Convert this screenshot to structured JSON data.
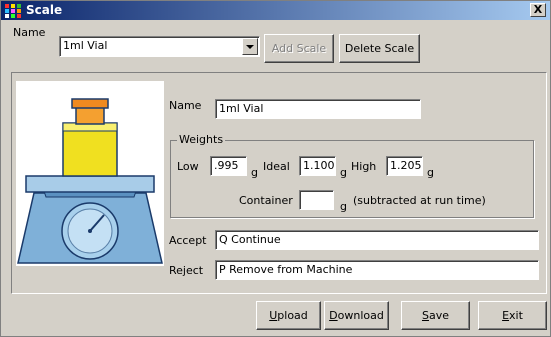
{
  "window": {
    "title": "Scale",
    "close_glyph": "X"
  },
  "header": {
    "name_label": "Name",
    "name_value": "1ml Vial",
    "add_scale_label": "Add Scale",
    "delete_scale_label": "Delete Scale"
  },
  "form": {
    "name_label": "Name",
    "name_value": "1ml Vial",
    "weights_legend": "Weights",
    "low_label": "Low",
    "low_value": ".995",
    "ideal_label": "Ideal",
    "ideal_value": "1.100",
    "high_label": "High",
    "high_value": "1.205",
    "unit": "g",
    "container_label": "Container",
    "container_value": "",
    "subtracted_note": "(subtracted at run time)",
    "accept_label": "Accept",
    "accept_value": "Q Continue",
    "reject_label": "Reject",
    "reject_value": "P Remove from Machine"
  },
  "buttons": {
    "upload": {
      "first": "U",
      "rest": "pload"
    },
    "download": {
      "first": "D",
      "rest": "ownload"
    },
    "save": {
      "first": "S",
      "rest": "ave"
    },
    "exit": {
      "first": "E",
      "rest": "xit"
    }
  },
  "icons": [
    "app-icon",
    "close-icon",
    "dropdown-arrow-icon",
    "scale-illustration"
  ],
  "colors": {
    "title_start": "#0a246a",
    "title_end": "#a6caf0",
    "face": "#d4d0c8"
  }
}
